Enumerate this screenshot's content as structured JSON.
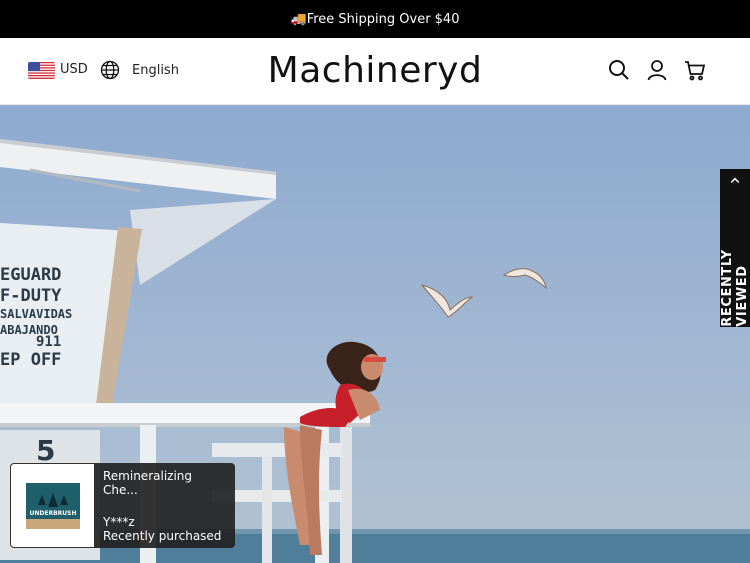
{
  "announcement": {
    "text": "🚚Free Shipping Over $40"
  },
  "header": {
    "currency": "USD",
    "language": "English",
    "logo": "Machineryd"
  },
  "hero": {
    "sign_lines": [
      "EGUARD",
      "F-DUTY",
      "SALVAVIDAS",
      "ABAJANDO",
      "911",
      "EP OFF"
    ],
    "tower_number": "5"
  },
  "recently_viewed": {
    "label": "RECENTLY VIEWED"
  },
  "purchase_popup": {
    "product": "Remineralizing Che...",
    "buyer": "Y***z",
    "status": "Recently purchased",
    "product_image_text": "UNDERBRUSH"
  },
  "colors": {
    "announcement_bg": "#000000",
    "sky": "#9db4cf",
    "swimsuit": "#c8202a",
    "popup_bg": "#222222"
  },
  "icons": {
    "search": "search-icon",
    "account": "user-icon",
    "cart": "cart-icon",
    "language": "globe-icon",
    "currency_flag": "us-flag-icon"
  }
}
